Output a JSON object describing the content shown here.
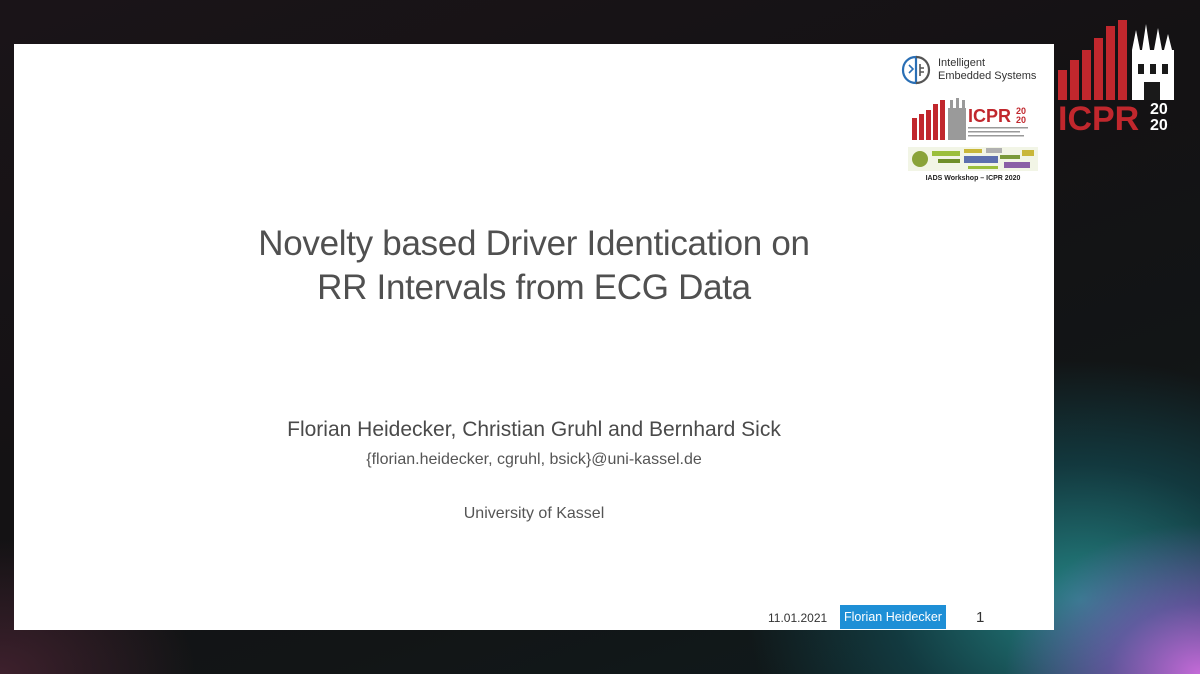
{
  "slide": {
    "title_line1": "Novelty based Driver Identication on",
    "title_line2": "RR Intervals from ECG Data",
    "authors": "Florian Heidecker, Christian Gruhl and Bernhard Sick",
    "emails": "{florian.heidecker, cgruhl, bsick}@uni-kassel.de",
    "affiliation": "University of Kassel",
    "footer": {
      "date": "11.01.2021",
      "presenter": "Florian Heidecker",
      "page": "1"
    },
    "logos": {
      "ies_line1": "Intelligent",
      "ies_line2": "Embedded Systems",
      "icpr_small": "ICPR",
      "icpr_small_year_top": "20",
      "icpr_small_year_bottom": "20",
      "iads_caption": "IADS Workshop – ICPR 2020"
    }
  },
  "overlay_logo": {
    "text": "ICPR",
    "year_top": "20",
    "year_bottom": "20"
  },
  "colors": {
    "accent_blue": "#1e8fd6",
    "icpr_red": "#c1272d"
  }
}
